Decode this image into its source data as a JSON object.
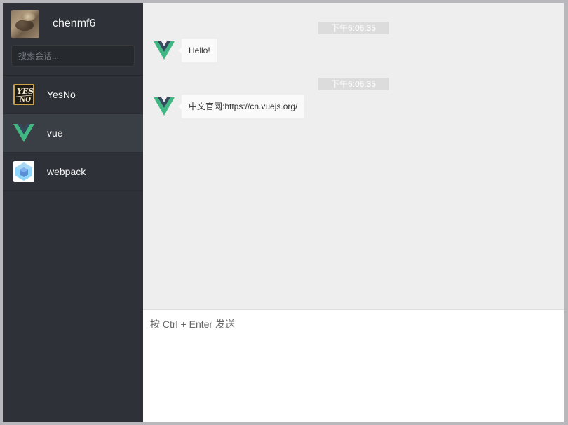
{
  "user": {
    "name": "chenmf6",
    "avatar_icon": "user-avatar-photo"
  },
  "search": {
    "placeholder": "搜索会话...",
    "value": ""
  },
  "sessions": [
    {
      "name": "YesNo",
      "icon": "yesno-logo-icon",
      "active": false
    },
    {
      "name": "vue",
      "icon": "vue-logo-icon",
      "active": true
    },
    {
      "name": "webpack",
      "icon": "webpack-logo-icon",
      "active": false
    }
  ],
  "messages": [
    {
      "time": "下午6:06:35",
      "text": "Hello!",
      "sender_icon": "vue-logo-icon"
    },
    {
      "time": "下午6:06:35",
      "text": "中文官网:https://cn.vuejs.org/",
      "sender_icon": "vue-logo-icon"
    }
  ],
  "composer": {
    "placeholder": "按 Ctrl + Enter 发送",
    "value": ""
  },
  "colors": {
    "sidebar_bg": "#2e3238",
    "active_session_bg": "#3a3f45",
    "message_area_bg": "#eeeeee",
    "vue_green": "#41b883",
    "vue_dark": "#35495e"
  }
}
